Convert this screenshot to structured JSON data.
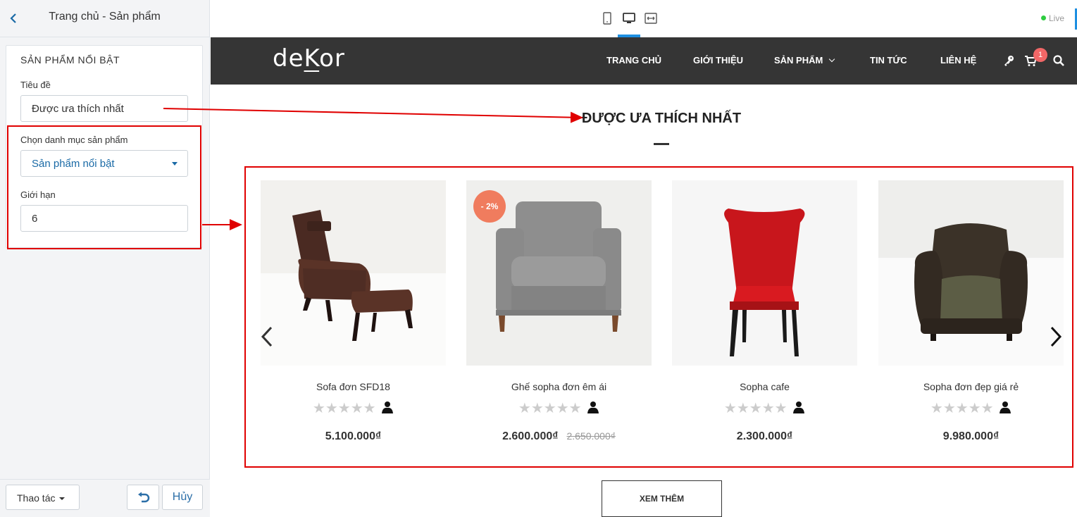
{
  "sidebar": {
    "back_icon": "chevron-left-icon",
    "title": "Trang chủ - Sản phẩm",
    "section_title": "SẢN PHẨM NỔI BẬT",
    "fields": {
      "title_label": "Tiêu đề",
      "title_value": "Được ưa thích nhất",
      "category_label": "Chọn danh mục sản phẩm",
      "category_value": "Sản phẩm nổi bật",
      "limit_label": "Giới hạn",
      "limit_value": "6"
    },
    "footer": {
      "action_label": "Thao tác",
      "undo_icon": "undo-icon",
      "cancel_label": "Hủy"
    }
  },
  "toolbar": {
    "device_icons": [
      "mobile-icon",
      "desktop-icon",
      "fullwidth-icon"
    ],
    "live_label": "Live",
    "accent": "#1e8fe1"
  },
  "site": {
    "logo": {
      "part1": "de",
      "part2": "K",
      "part3": "or"
    },
    "nav": [
      "TRANG CHỦ",
      "GIỚI THIỆU",
      "SẢN PHẨM",
      "TIN TỨC",
      "LIÊN HỆ"
    ],
    "cart_count": "1",
    "section_title": "ĐƯỢC ƯA THÍCH NHẤT",
    "products": [
      {
        "name": "Sofa đơn SFD18",
        "price": "5.100.000₫",
        "old_price": "",
        "badge": "",
        "rating": 0
      },
      {
        "name": "Ghế sopha đơn êm ái",
        "price": "2.600.000₫",
        "old_price": "2.650.000₫",
        "badge": "- 2%",
        "rating": 0
      },
      {
        "name": "Sopha cafe",
        "price": "2.300.000₫",
        "old_price": "",
        "badge": "",
        "rating": 0
      },
      {
        "name": "Sopha đơn đẹp giá rẻ",
        "price": "9.980.000₫",
        "old_price": "",
        "badge": "",
        "rating": 0
      }
    ],
    "more_button": "XEM THÊM",
    "header_bg": "#353535",
    "badge_color": "#f07c5e"
  },
  "annotation_color": "#e00000"
}
